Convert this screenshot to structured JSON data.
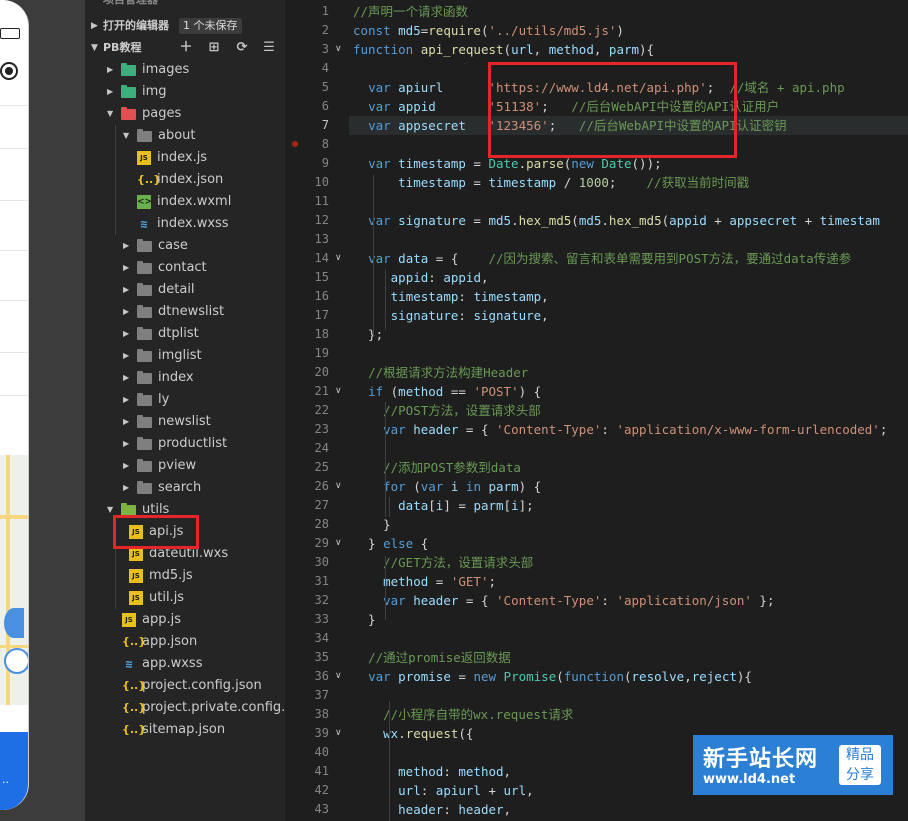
{
  "explorer": {
    "top_label": "项目管理器",
    "open_editors": {
      "label": "打开的编辑器",
      "badge": "1 个未保存"
    },
    "project": {
      "label": "PB教程"
    },
    "tree": [
      {
        "name": "images",
        "type": "folder-green",
        "depth": 1,
        "arrow": "right"
      },
      {
        "name": "img",
        "type": "folder-green",
        "depth": 1,
        "arrow": "right"
      },
      {
        "name": "pages",
        "type": "folder-red",
        "depth": 1,
        "arrow": "down"
      },
      {
        "name": "about",
        "type": "folder",
        "depth": 2,
        "arrow": "down"
      },
      {
        "name": "index.js",
        "type": "js",
        "depth": 3
      },
      {
        "name": "index.json",
        "type": "json",
        "depth": 3
      },
      {
        "name": "index.wxml",
        "type": "wxml",
        "depth": 3
      },
      {
        "name": "index.wxss",
        "type": "wxss",
        "depth": 3
      },
      {
        "name": "case",
        "type": "folder",
        "depth": 2,
        "arrow": "right"
      },
      {
        "name": "contact",
        "type": "folder",
        "depth": 2,
        "arrow": "right"
      },
      {
        "name": "detail",
        "type": "folder",
        "depth": 2,
        "arrow": "right"
      },
      {
        "name": "dtnewslist",
        "type": "folder",
        "depth": 2,
        "arrow": "right"
      },
      {
        "name": "dtplist",
        "type": "folder",
        "depth": 2,
        "arrow": "right"
      },
      {
        "name": "imglist",
        "type": "folder",
        "depth": 2,
        "arrow": "right"
      },
      {
        "name": "index",
        "type": "folder",
        "depth": 2,
        "arrow": "right"
      },
      {
        "name": "ly",
        "type": "folder",
        "depth": 2,
        "arrow": "right"
      },
      {
        "name": "newslist",
        "type": "folder",
        "depth": 2,
        "arrow": "right"
      },
      {
        "name": "productlist",
        "type": "folder",
        "depth": 2,
        "arrow": "right"
      },
      {
        "name": "pview",
        "type": "folder",
        "depth": 2,
        "arrow": "right"
      },
      {
        "name": "search",
        "type": "folder",
        "depth": 2,
        "arrow": "right"
      },
      {
        "name": "utils",
        "type": "folder-utils",
        "depth": 1,
        "arrow": "down"
      },
      {
        "name": "api.js",
        "type": "js",
        "depth": 2
      },
      {
        "name": "dateutil.wxs",
        "type": "wxs",
        "depth": 2
      },
      {
        "name": "md5.js",
        "type": "js",
        "depth": 2
      },
      {
        "name": "util.js",
        "type": "js",
        "depth": 2
      },
      {
        "name": "app.js",
        "type": "js",
        "depth": 1
      },
      {
        "name": "app.json",
        "type": "json",
        "depth": 1
      },
      {
        "name": "app.wxss",
        "type": "wxss",
        "depth": 1
      },
      {
        "name": "project.config.json",
        "type": "json",
        "depth": 1
      },
      {
        "name": "project.private.config.js...",
        "type": "json",
        "depth": 1
      },
      {
        "name": "sitemap.json",
        "type": "json",
        "depth": 1
      }
    ]
  },
  "phone": {
    "bottom_label": "··"
  },
  "editor": {
    "active_line": 7,
    "lines": [
      {
        "n": 1,
        "fold": "",
        "tokens": [
          [
            "cm",
            "//声明一个请求函数"
          ]
        ]
      },
      {
        "n": 2,
        "fold": "",
        "tokens": [
          [
            "kw",
            "const "
          ],
          [
            "id",
            "md5"
          ],
          [
            "op",
            "="
          ],
          [
            "fn",
            "require"
          ],
          [
            "op",
            "("
          ],
          [
            "st",
            "'../utils/md5.js'"
          ],
          [
            "op",
            ")"
          ]
        ]
      },
      {
        "n": 3,
        "fold": "v",
        "tokens": [
          [
            "kw",
            "function "
          ],
          [
            "fn",
            "api_request"
          ],
          [
            "op",
            "("
          ],
          [
            "id",
            "url"
          ],
          [
            "op",
            ", "
          ],
          [
            "id",
            "method"
          ],
          [
            "op",
            ", "
          ],
          [
            "id",
            "parm"
          ],
          [
            "op",
            "){"
          ]
        ]
      },
      {
        "n": 4,
        "fold": "",
        "tokens": []
      },
      {
        "n": 5,
        "fold": "",
        "tokens": [
          [
            "op",
            "  "
          ],
          [
            "kw",
            "var "
          ],
          [
            "id",
            "apiurl"
          ],
          [
            "op",
            "      "
          ],
          [
            "st",
            "'https://www.ld4.net/api.php'"
          ],
          [
            "op",
            ";  "
          ],
          [
            "cm",
            "//域名 + api.php"
          ]
        ]
      },
      {
        "n": 6,
        "fold": "",
        "tokens": [
          [
            "op",
            "  "
          ],
          [
            "kw",
            "var "
          ],
          [
            "id",
            "appid"
          ],
          [
            "op",
            "       "
          ],
          [
            "st",
            "'51138'"
          ],
          [
            "op",
            ";   "
          ],
          [
            "cm",
            "//后台WebAPI中设置的API认证用户"
          ]
        ]
      },
      {
        "n": 7,
        "fold": "",
        "tokens": [
          [
            "op",
            "  "
          ],
          [
            "kw",
            "var "
          ],
          [
            "id",
            "appsecret"
          ],
          [
            "op",
            "   "
          ],
          [
            "st",
            "'123456'"
          ],
          [
            "op",
            ";   "
          ],
          [
            "cm",
            "//后台WebAPI中设置的API认证密钥"
          ]
        ]
      },
      {
        "n": 8,
        "fold": "",
        "tokens": []
      },
      {
        "n": 9,
        "fold": "",
        "tokens": [
          [
            "op",
            "  "
          ],
          [
            "kw",
            "var "
          ],
          [
            "id",
            "timestamp"
          ],
          [
            "op",
            " = "
          ],
          [
            "cls",
            "Date"
          ],
          [
            "op",
            "."
          ],
          [
            "fn",
            "parse"
          ],
          [
            "op",
            "("
          ],
          [
            "kw",
            "new "
          ],
          [
            "cls",
            "Date"
          ],
          [
            "op",
            "());"
          ]
        ]
      },
      {
        "n": 10,
        "fold": "",
        "tokens": [
          [
            "op",
            "      "
          ],
          [
            "id",
            "timestamp"
          ],
          [
            "op",
            " = "
          ],
          [
            "id",
            "timestamp"
          ],
          [
            "op",
            " / "
          ],
          [
            "nm",
            "1000"
          ],
          [
            "op",
            ";    "
          ],
          [
            "cm",
            "//获取当前时间戳"
          ]
        ]
      },
      {
        "n": 11,
        "fold": "",
        "tokens": []
      },
      {
        "n": 12,
        "fold": "",
        "tokens": [
          [
            "op",
            "  "
          ],
          [
            "kw",
            "var "
          ],
          [
            "id",
            "signature"
          ],
          [
            "op",
            " = "
          ],
          [
            "id",
            "md5"
          ],
          [
            "op",
            "."
          ],
          [
            "fn",
            "hex_md5"
          ],
          [
            "op",
            "("
          ],
          [
            "id",
            "md5"
          ],
          [
            "op",
            "."
          ],
          [
            "fn",
            "hex_md5"
          ],
          [
            "op",
            "("
          ],
          [
            "id",
            "appid"
          ],
          [
            "op",
            " + "
          ],
          [
            "id",
            "appsecret"
          ],
          [
            "op",
            " + "
          ],
          [
            "id",
            "timestam"
          ]
        ]
      },
      {
        "n": 13,
        "fold": "",
        "tokens": []
      },
      {
        "n": 14,
        "fold": "v",
        "tokens": [
          [
            "op",
            "  "
          ],
          [
            "kw",
            "var "
          ],
          [
            "id",
            "data"
          ],
          [
            "op",
            " = {    "
          ],
          [
            "cm",
            "//因为搜索、留言和表单需要用到POST方法，要通过data传递参"
          ]
        ]
      },
      {
        "n": 15,
        "fold": "",
        "tokens": [
          [
            "op",
            "     "
          ],
          [
            "id",
            "appid"
          ],
          [
            "op",
            ": "
          ],
          [
            "id",
            "appid"
          ],
          [
            "op",
            ","
          ]
        ]
      },
      {
        "n": 16,
        "fold": "",
        "tokens": [
          [
            "op",
            "     "
          ],
          [
            "id",
            "timestamp"
          ],
          [
            "op",
            ": "
          ],
          [
            "id",
            "timestamp"
          ],
          [
            "op",
            ","
          ]
        ]
      },
      {
        "n": 17,
        "fold": "",
        "tokens": [
          [
            "op",
            "     "
          ],
          [
            "id",
            "signature"
          ],
          [
            "op",
            ": "
          ],
          [
            "id",
            "signature"
          ],
          [
            "op",
            ","
          ]
        ]
      },
      {
        "n": 18,
        "fold": "",
        "tokens": [
          [
            "op",
            "  };"
          ]
        ]
      },
      {
        "n": 19,
        "fold": "",
        "tokens": []
      },
      {
        "n": 20,
        "fold": "",
        "tokens": [
          [
            "op",
            "  "
          ],
          [
            "cm",
            "//根据请求方法构建Header"
          ]
        ]
      },
      {
        "n": 21,
        "fold": "v",
        "tokens": [
          [
            "op",
            "  "
          ],
          [
            "kw",
            "if "
          ],
          [
            "op",
            "("
          ],
          [
            "id",
            "method"
          ],
          [
            "op",
            " == "
          ],
          [
            "st",
            "'POST'"
          ],
          [
            "op",
            ") {"
          ]
        ]
      },
      {
        "n": 22,
        "fold": "",
        "tokens": [
          [
            "op",
            "    "
          ],
          [
            "cm",
            "//POST方法，设置请求头部"
          ]
        ]
      },
      {
        "n": 23,
        "fold": "",
        "tokens": [
          [
            "op",
            "    "
          ],
          [
            "kw",
            "var "
          ],
          [
            "id",
            "header"
          ],
          [
            "op",
            " = { "
          ],
          [
            "st",
            "'Content-Type'"
          ],
          [
            "op",
            ": "
          ],
          [
            "st",
            "'application/x-www-form-urlencoded'"
          ],
          [
            "op",
            ";"
          ]
        ]
      },
      {
        "n": 24,
        "fold": "",
        "tokens": []
      },
      {
        "n": 25,
        "fold": "",
        "tokens": [
          [
            "op",
            "    "
          ],
          [
            "cm",
            "//添加POST参数到data"
          ]
        ]
      },
      {
        "n": 26,
        "fold": "v",
        "tokens": [
          [
            "op",
            "    "
          ],
          [
            "kw",
            "for "
          ],
          [
            "op",
            "("
          ],
          [
            "kw",
            "var "
          ],
          [
            "id",
            "i"
          ],
          [
            "kw",
            " in "
          ],
          [
            "id",
            "parm"
          ],
          [
            "op",
            ") {"
          ]
        ]
      },
      {
        "n": 27,
        "fold": "",
        "tokens": [
          [
            "op",
            "      "
          ],
          [
            "id",
            "data"
          ],
          [
            "op",
            "["
          ],
          [
            "id",
            "i"
          ],
          [
            "op",
            "] = "
          ],
          [
            "id",
            "parm"
          ],
          [
            "op",
            "["
          ],
          [
            "id",
            "i"
          ],
          [
            "op",
            "];"
          ]
        ]
      },
      {
        "n": 28,
        "fold": "",
        "tokens": [
          [
            "op",
            "    }"
          ]
        ]
      },
      {
        "n": 29,
        "fold": "v",
        "tokens": [
          [
            "op",
            "  } "
          ],
          [
            "kw",
            "else "
          ],
          [
            "op",
            "{"
          ]
        ]
      },
      {
        "n": 30,
        "fold": "",
        "tokens": [
          [
            "op",
            "    "
          ],
          [
            "cm",
            "//GET方法，设置请求头部"
          ]
        ]
      },
      {
        "n": 31,
        "fold": "",
        "tokens": [
          [
            "op",
            "    "
          ],
          [
            "id",
            "method"
          ],
          [
            "op",
            " = "
          ],
          [
            "st",
            "'GET'"
          ],
          [
            "op",
            ";"
          ]
        ]
      },
      {
        "n": 32,
        "fold": "",
        "tokens": [
          [
            "op",
            "    "
          ],
          [
            "kw",
            "var "
          ],
          [
            "id",
            "header"
          ],
          [
            "op",
            " = { "
          ],
          [
            "st",
            "'Content-Type'"
          ],
          [
            "op",
            ": "
          ],
          [
            "st",
            "'application/json'"
          ],
          [
            "op",
            " };"
          ]
        ]
      },
      {
        "n": 33,
        "fold": "",
        "tokens": [
          [
            "op",
            "  }"
          ]
        ]
      },
      {
        "n": 34,
        "fold": "",
        "tokens": []
      },
      {
        "n": 35,
        "fold": "",
        "tokens": [
          [
            "op",
            "  "
          ],
          [
            "cm",
            "//通过promise返回数据"
          ]
        ]
      },
      {
        "n": 36,
        "fold": "v",
        "tokens": [
          [
            "op",
            "  "
          ],
          [
            "kw",
            "var "
          ],
          [
            "id",
            "promise"
          ],
          [
            "op",
            " = "
          ],
          [
            "kw",
            "new "
          ],
          [
            "cls",
            "Promise"
          ],
          [
            "op",
            "("
          ],
          [
            "kw",
            "function"
          ],
          [
            "op",
            "("
          ],
          [
            "id",
            "resolve"
          ],
          [
            "op",
            ","
          ],
          [
            "id",
            "reject"
          ],
          [
            "op",
            "){"
          ]
        ]
      },
      {
        "n": 37,
        "fold": "",
        "tokens": []
      },
      {
        "n": 38,
        "fold": "",
        "tokens": [
          [
            "op",
            "    "
          ],
          [
            "cm",
            "//小程序自带的wx.request请求"
          ]
        ]
      },
      {
        "n": 39,
        "fold": "v",
        "tokens": [
          [
            "op",
            "    "
          ],
          [
            "id",
            "wx"
          ],
          [
            "op",
            "."
          ],
          [
            "fn",
            "request"
          ],
          [
            "op",
            "({"
          ]
        ]
      },
      {
        "n": 40,
        "fold": "",
        "tokens": []
      },
      {
        "n": 41,
        "fold": "",
        "tokens": [
          [
            "op",
            "      "
          ],
          [
            "id",
            "method"
          ],
          [
            "op",
            ": "
          ],
          [
            "id",
            "method"
          ],
          [
            "op",
            ","
          ]
        ]
      },
      {
        "n": 42,
        "fold": "",
        "tokens": [
          [
            "op",
            "      "
          ],
          [
            "id",
            "url"
          ],
          [
            "op",
            ": "
          ],
          [
            "id",
            "apiurl"
          ],
          [
            "op",
            " + "
          ],
          [
            "id",
            "url"
          ],
          [
            "op",
            ","
          ]
        ]
      },
      {
        "n": 43,
        "fold": "",
        "tokens": [
          [
            "op",
            "      "
          ],
          [
            "id",
            "header"
          ],
          [
            "op",
            ": "
          ],
          [
            "id",
            "header"
          ],
          [
            "op",
            ","
          ]
        ]
      }
    ]
  },
  "watermark": {
    "title": "新手站长网",
    "url": "www.ld4.net",
    "tag_line1": "精品",
    "tag_line2": "分享"
  },
  "colors": {
    "highlight_box": "#e5252a",
    "watermark_bg": "#2b7fd4"
  }
}
